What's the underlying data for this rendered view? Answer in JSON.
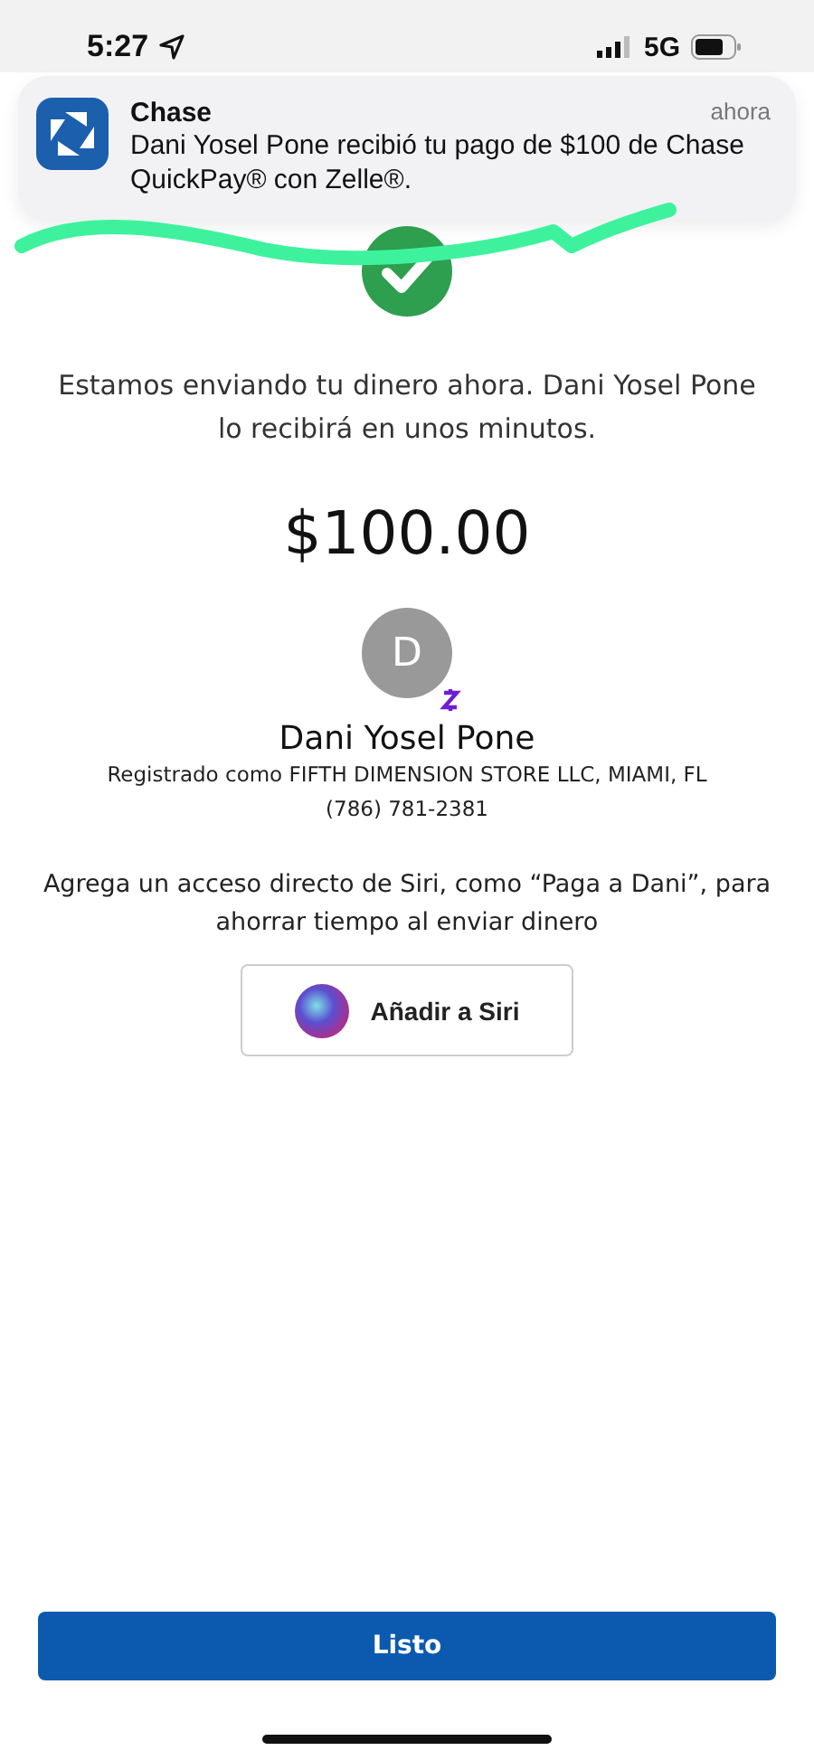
{
  "status_bar": {
    "time": "5:27",
    "network": "5G"
  },
  "notification": {
    "app": "Chase",
    "time": "ahora",
    "message": "Dani Yosel Pone recibió tu pago de $100 de Chase QuickPay® con Zelle®."
  },
  "confirmation": {
    "message": "Estamos enviando tu dinero ahora. Dani Yosel Pone lo recibirá en unos minutos.",
    "amount": "$100.00"
  },
  "recipient": {
    "initial": "D",
    "name": "Dani Yosel Pone",
    "registered": "Registrado como FIFTH DIMENSION STORE LLC, MIAMI, FL",
    "phone": "(786) 781-2381"
  },
  "siri": {
    "text": "Agrega un acceso directo de Siri, como “Paga a Dani”, para ahorrar tiempo al enviar dinero",
    "button": "Añadir a Siri"
  },
  "done_button": "Listo"
}
